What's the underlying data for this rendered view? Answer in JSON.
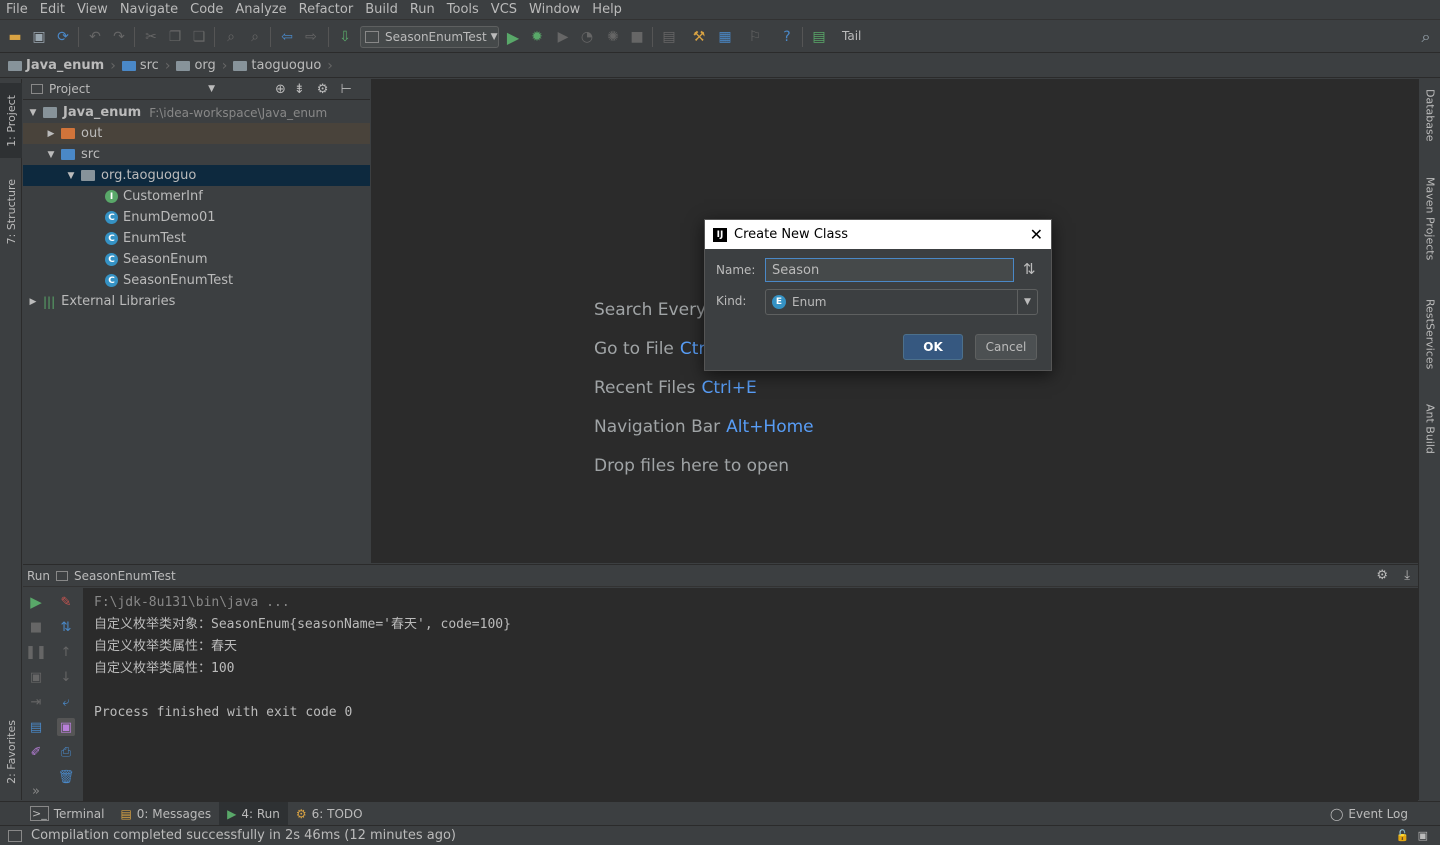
{
  "menu": [
    "File",
    "Edit",
    "View",
    "Navigate",
    "Code",
    "Analyze",
    "Refactor",
    "Build",
    "Run",
    "Tools",
    "VCS",
    "Window",
    "Help"
  ],
  "toolbar": {
    "run_config": "SeasonEnumTest",
    "tail_label": "Tail"
  },
  "breadcrumb": [
    "Java_enum",
    "src",
    "org",
    "taoguoguo"
  ],
  "left_tabs": {
    "project": "1: Project",
    "structure": "7: Structure",
    "favorites": "2: Favorites"
  },
  "right_tabs": {
    "database": "Database",
    "maven": "Maven Projects",
    "rest": "RestServices",
    "ant": "Ant Build"
  },
  "project": {
    "header": "Project",
    "tree": [
      {
        "label": "Java_enum",
        "path": "F:\\idea-workspace\\Java_enum"
      },
      {
        "label": "out"
      },
      {
        "label": "src"
      },
      {
        "label": "org.taoguoguo"
      },
      {
        "label": "CustomerInf",
        "kind": "I"
      },
      {
        "label": "EnumDemo01",
        "kind": "C"
      },
      {
        "label": "EnumTest",
        "kind": "C"
      },
      {
        "label": "SeasonEnum",
        "kind": "C"
      },
      {
        "label": "SeasonEnumTest",
        "kind": "C"
      },
      {
        "label": "External Libraries"
      }
    ]
  },
  "editor_hints": [
    {
      "text": "Search Everyw",
      "key": ""
    },
    {
      "text": "Go to File",
      "key": "Ctrl"
    },
    {
      "text": "Recent Files",
      "key": "Ctrl+E"
    },
    {
      "text": "Navigation Bar",
      "key": "Alt+Home"
    },
    {
      "text": "Drop files here to open",
      "key": ""
    }
  ],
  "dialog": {
    "title": "Create New Class",
    "name_label": "Name:",
    "name_value": "Season",
    "kind_label": "Kind:",
    "kind_value": "Enum",
    "kind_icon": "E",
    "ok": "OK",
    "cancel": "Cancel"
  },
  "run": {
    "header_label": "Run",
    "config": "SeasonEnumTest",
    "console": [
      "F:\\jdk-8u131\\bin\\java ...",
      "自定义枚举类对象：SeasonEnum{seasonName='春天', code=100}",
      "自定义枚举类属性：春天",
      "自定义枚举类属性：100",
      "",
      "Process finished with exit code 0"
    ]
  },
  "bottom_tabs": {
    "terminal": "Terminal",
    "messages": "0: Messages",
    "run": "4: Run",
    "todo": "6: TODO",
    "event_log": "Event Log"
  },
  "status": "Compilation completed successfully in 2s 46ms (12 minutes ago)",
  "colors": {
    "accent": "#589df6",
    "selection": "#0d293e",
    "ok_button": "#365880",
    "run_green": "#59a869"
  }
}
